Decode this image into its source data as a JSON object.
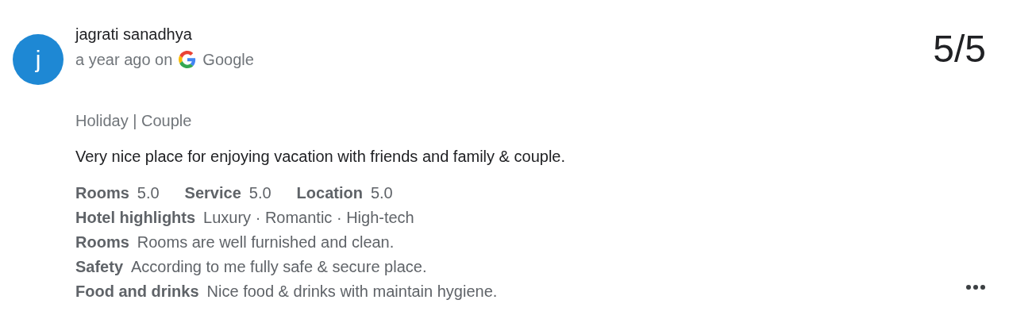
{
  "review": {
    "avatar_letter": "j",
    "author": "jagrati sanadhya",
    "time": "a year ago on",
    "source": "Google",
    "score": "5/5",
    "trip": "Holiday | Couple",
    "text": "Very nice place for enjoying vacation with friends and family & couple.",
    "ratings": [
      {
        "label": "Rooms",
        "value": "5.0"
      },
      {
        "label": "Service",
        "value": "5.0"
      },
      {
        "label": "Location",
        "value": "5.0"
      }
    ],
    "details": [
      {
        "label": "Hotel highlights",
        "text": "Luxury · Romantic · High-tech"
      },
      {
        "label": "Rooms",
        "text": "Rooms are well furnished and clean."
      },
      {
        "label": "Safety",
        "text": "According to me fully safe & secure place."
      },
      {
        "label": "Food and drinks",
        "text": "Nice food & drinks with maintain hygiene."
      }
    ]
  }
}
